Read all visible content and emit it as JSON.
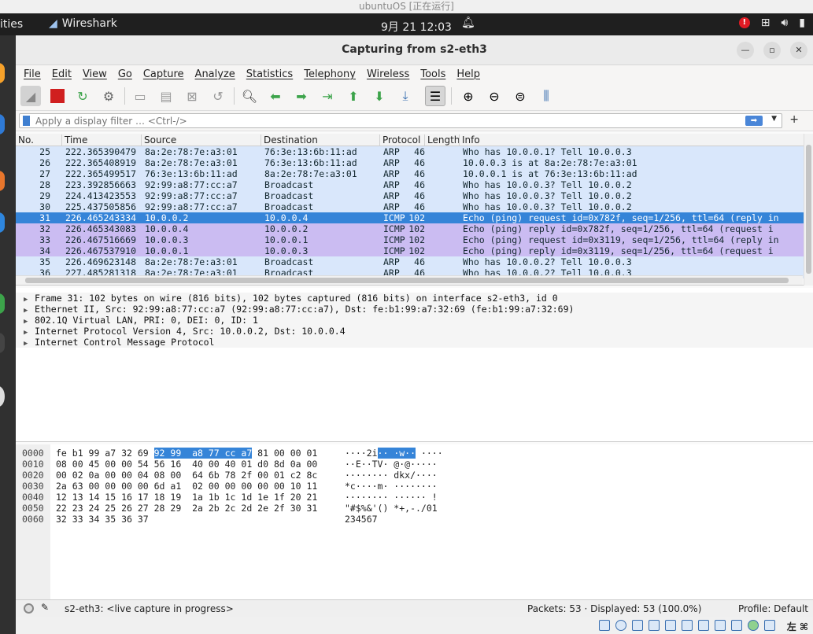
{
  "vm": {
    "title": "ubuntuOS [正在运行]"
  },
  "topbar": {
    "activities": "ities",
    "app_name": "Wireshark",
    "clock": "9月 21  12:03"
  },
  "window": {
    "title": "Capturing from s2-eth3"
  },
  "menu": [
    "File",
    "Edit",
    "View",
    "Go",
    "Capture",
    "Analyze",
    "Statistics",
    "Telephony",
    "Wireless",
    "Tools",
    "Help"
  ],
  "filter": {
    "placeholder": "Apply a display filter … <Ctrl-/>"
  },
  "columns": {
    "no": "No.",
    "time": "Time",
    "source": "Source",
    "destination": "Destination",
    "protocol": "Protocol",
    "length": "Length",
    "info": "Info"
  },
  "packets": [
    {
      "no": "25",
      "time": "222.365390479",
      "src": "8a:2e:78:7e:a3:01",
      "dst": "76:3e:13:6b:11:ad",
      "proto": "ARP",
      "len": "46",
      "info": "Who has 10.0.0.1? Tell 10.0.0.3",
      "kind": "arp"
    },
    {
      "no": "26",
      "time": "222.365408919",
      "src": "8a:2e:78:7e:a3:01",
      "dst": "76:3e:13:6b:11:ad",
      "proto": "ARP",
      "len": "46",
      "info": "10.0.0.3 is at 8a:2e:78:7e:a3:01",
      "kind": "arp"
    },
    {
      "no": "27",
      "time": "222.365499517",
      "src": "76:3e:13:6b:11:ad",
      "dst": "8a:2e:78:7e:a3:01",
      "proto": "ARP",
      "len": "46",
      "info": "10.0.0.1 is at 76:3e:13:6b:11:ad",
      "kind": "arp"
    },
    {
      "no": "28",
      "time": "223.392856663",
      "src": "92:99:a8:77:cc:a7",
      "dst": "Broadcast",
      "proto": "ARP",
      "len": "46",
      "info": "Who has 10.0.0.3? Tell 10.0.0.2",
      "kind": "arp"
    },
    {
      "no": "29",
      "time": "224.413423553",
      "src": "92:99:a8:77:cc:a7",
      "dst": "Broadcast",
      "proto": "ARP",
      "len": "46",
      "info": "Who has 10.0.0.3? Tell 10.0.0.2",
      "kind": "arp"
    },
    {
      "no": "30",
      "time": "225.437505856",
      "src": "92:99:a8:77:cc:a7",
      "dst": "Broadcast",
      "proto": "ARP",
      "len": "46",
      "info": "Who has 10.0.0.3? Tell 10.0.0.2",
      "kind": "arp"
    },
    {
      "no": "31",
      "time": "226.465243334",
      "src": "10.0.0.2",
      "dst": "10.0.0.4",
      "proto": "ICMP",
      "len": "102",
      "info": "Echo (ping) request  id=0x782f, seq=1/256, ttl=64 (reply in",
      "kind": "sel"
    },
    {
      "no": "32",
      "time": "226.465343083",
      "src": "10.0.0.4",
      "dst": "10.0.0.2",
      "proto": "ICMP",
      "len": "102",
      "info": "Echo (ping) reply    id=0x782f, seq=1/256, ttl=64 (request i",
      "kind": "icmp"
    },
    {
      "no": "33",
      "time": "226.467516669",
      "src": "10.0.0.3",
      "dst": "10.0.0.1",
      "proto": "ICMP",
      "len": "102",
      "info": "Echo (ping) request  id=0x3119, seq=1/256, ttl=64 (reply in",
      "kind": "icmp"
    },
    {
      "no": "34",
      "time": "226.467537910",
      "src": "10.0.0.1",
      "dst": "10.0.0.3",
      "proto": "ICMP",
      "len": "102",
      "info": "Echo (ping) reply    id=0x3119, seq=1/256, ttl=64 (request i",
      "kind": "icmp"
    },
    {
      "no": "35",
      "time": "226.469623148",
      "src": "8a:2e:78:7e:a3:01",
      "dst": "Broadcast",
      "proto": "ARP",
      "len": "46",
      "info": "Who has 10.0.0.2? Tell 10.0.0.3",
      "kind": "arp"
    },
    {
      "no": "36",
      "time": "227.485281318",
      "src": "8a:2e:78:7e:a3:01",
      "dst": "Broadcast",
      "proto": "ARP",
      "len": "46",
      "info": "Who has 10.0.0.2? Tell 10.0.0.3",
      "kind": "arp"
    }
  ],
  "details": [
    "Frame 31: 102 bytes on wire (816 bits), 102 bytes captured (816 bits) on interface s2-eth3, id 0",
    "Ethernet II, Src: 92:99:a8:77:cc:a7 (92:99:a8:77:cc:a7), Dst: fe:b1:99:a7:32:69 (fe:b1:99:a7:32:69)",
    "802.1Q Virtual LAN, PRI: 0, DEI: 0, ID: 1",
    "Internet Protocol Version 4, Src: 10.0.0.2, Dst: 10.0.0.4",
    "Internet Control Message Protocol"
  ],
  "bytes": [
    {
      "off": "0000",
      "hex_a": "fe b1 99 a7 32 69 ",
      "hex_hl": "92 99  a8 77 cc a7",
      "hex_b": " 81 00 00 01",
      "asc_a": "····2i",
      "asc_hl": "·· ·w··",
      "asc_b": " ····"
    },
    {
      "off": "0010",
      "hex_a": "08 00 45 00 00 54 56 16  40 00 40 01 d0 8d 0a 00",
      "hex_hl": "",
      "hex_b": "",
      "asc_a": "··E··TV· @·@·····",
      "asc_hl": "",
      "asc_b": ""
    },
    {
      "off": "0020",
      "hex_a": "00 02 0a 00 00 04 08 00  64 6b 78 2f 00 01 c2 8c",
      "hex_hl": "",
      "hex_b": "",
      "asc_a": "········ dkx/····",
      "asc_hl": "",
      "asc_b": ""
    },
    {
      "off": "0030",
      "hex_a": "2a 63 00 00 00 00 6d a1  02 00 00 00 00 00 10 11",
      "hex_hl": "",
      "hex_b": "",
      "asc_a": "*c····m· ········",
      "asc_hl": "",
      "asc_b": ""
    },
    {
      "off": "0040",
      "hex_a": "12 13 14 15 16 17 18 19  1a 1b 1c 1d 1e 1f 20 21",
      "hex_hl": "",
      "hex_b": "",
      "asc_a": "········ ······ !",
      "asc_hl": "",
      "asc_b": ""
    },
    {
      "off": "0050",
      "hex_a": "22 23 24 25 26 27 28 29  2a 2b 2c 2d 2e 2f 30 31",
      "hex_hl": "",
      "hex_b": "",
      "asc_a": "\"#$%&'() *+,-./01",
      "asc_hl": "",
      "asc_b": ""
    },
    {
      "off": "0060",
      "hex_a": "32 33 34 35 36 37",
      "hex_hl": "",
      "hex_b": "",
      "asc_a": "234567",
      "asc_hl": "",
      "asc_b": ""
    }
  ],
  "status": {
    "message": "s2-eth3: <live capture in progress>",
    "packets": "Packets: 53 · Displayed: 53 (100.0%)",
    "profile": "Profile: Default"
  },
  "tray": {
    "keyboard": "左 ⌘"
  },
  "colors": {
    "arp": "#d9e7fb",
    "icmp": "#cbbcf2",
    "selected": "#3584d8"
  }
}
